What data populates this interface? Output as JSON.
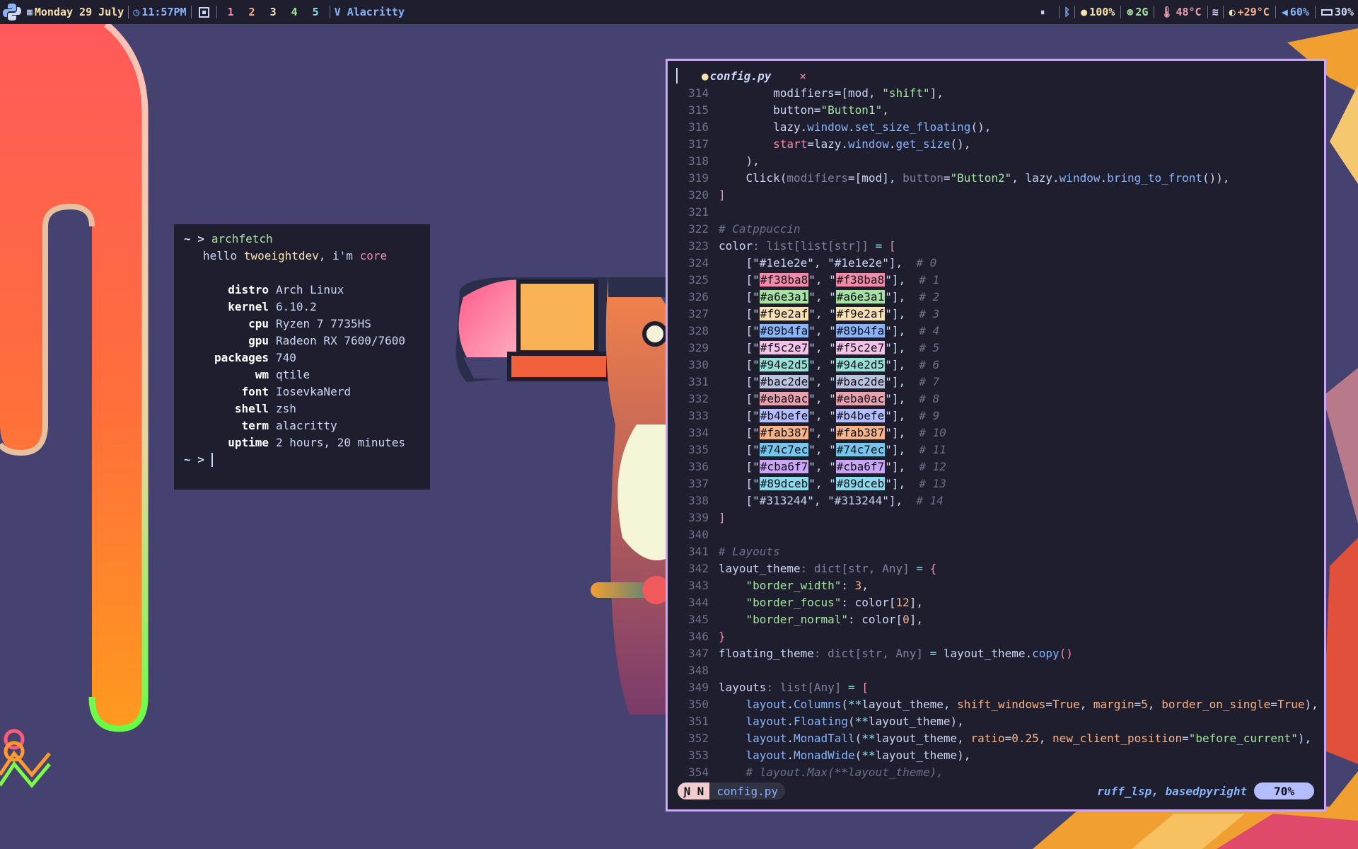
{
  "topbar": {
    "date": "Monday 29 July",
    "time": "11:57PM",
    "workspaces": [
      {
        "label": "1",
        "color": "#f38ba8"
      },
      {
        "label": "2",
        "color": "#fab387"
      },
      {
        "label": "3",
        "color": "#f9e2af"
      },
      {
        "label": "4",
        "color": "#a6e3a1"
      },
      {
        "label": "5",
        "color": "#89dceb"
      }
    ],
    "layout_glyph": "V",
    "window_title": "Alacritty",
    "pause_glyph": "⏸",
    "bluetooth_glyph": "ᛒ",
    "brightness": "100%",
    "memory": "2G",
    "cpu_temp": "48°C",
    "weather": "+29°C",
    "volume": "60%",
    "battery": "30%"
  },
  "fetch": {
    "prompt": "~ >",
    "command": "archfetch",
    "greeting_prefix": "hello ",
    "user": "twoeightdev",
    "greeting_mid": ", i'm ",
    "host": "core",
    "fields": [
      {
        "key": "distro",
        "value": "Arch Linux"
      },
      {
        "key": "kernel",
        "value": "6.10.2"
      },
      {
        "key": "cpu",
        "value": "Ryzen 7 7735HS"
      },
      {
        "key": "gpu",
        "value": "Radeon RX 7600/7600"
      },
      {
        "key": "packages",
        "value": "740"
      },
      {
        "key": "wm",
        "value": "qtile"
      },
      {
        "key": "font",
        "value": "IosevkaNerd"
      },
      {
        "key": "shell",
        "value": "zsh"
      },
      {
        "key": "term",
        "value": "alacritty"
      },
      {
        "key": "uptime",
        "value": "2 hours, 20 minutes"
      }
    ],
    "prompt2": "~ >"
  },
  "editor": {
    "tab_file": "config.py",
    "tab_close": "×",
    "mode": "N",
    "status_file": "config.py",
    "lsp": "ruff_lsp, basedpyright",
    "percent": "70%",
    "lines": [
      {
        "n": "314",
        "parts": [
          [
            "",
            "        modifiers=[mod, "
          ],
          [
            "str",
            "\"shift\""
          ],
          [
            "",
            "],"
          ]
        ]
      },
      {
        "n": "315",
        "parts": [
          [
            "",
            "        button="
          ],
          [
            "str",
            "\"Button1\""
          ],
          [
            "",
            ","
          ]
        ]
      },
      {
        "n": "316",
        "parts": [
          [
            "",
            "        lazy."
          ],
          [
            "fn",
            "window"
          ],
          [
            "",
            "."
          ],
          [
            "fn",
            "set_size_floating"
          ],
          [
            "",
            "(),"
          ]
        ]
      },
      {
        "n": "317",
        "parts": [
          [
            "red",
            "        start"
          ],
          [
            "",
            "=lazy."
          ],
          [
            "fn",
            "window"
          ],
          [
            "",
            "."
          ],
          [
            "fn",
            "get_size"
          ],
          [
            "",
            "(),"
          ]
        ]
      },
      {
        "n": "318",
        "parts": [
          [
            "",
            "    ),"
          ]
        ]
      },
      {
        "n": "319",
        "parts": [
          [
            "",
            "    Click("
          ],
          [
            "ty",
            "modifiers"
          ],
          [
            "",
            "=[mod], "
          ],
          [
            "ty",
            "button"
          ],
          [
            "",
            "="
          ],
          [
            "str",
            "\"Button2\""
          ],
          [
            "",
            ", lazy."
          ],
          [
            "fn",
            "window"
          ],
          [
            "",
            "."
          ],
          [
            "fn",
            "bring_to_front"
          ],
          [
            "",
            "()),"
          ]
        ]
      },
      {
        "n": "320",
        "parts": [
          [
            "red",
            "]"
          ]
        ]
      },
      {
        "n": "321",
        "parts": []
      },
      {
        "n": "322",
        "parts": [
          [
            "cm",
            "# Catppuccin"
          ]
        ]
      },
      {
        "n": "323",
        "parts": [
          [
            "",
            "color"
          ],
          [
            "ty",
            ": list[list[str]]"
          ],
          [
            "op",
            " = "
          ],
          [
            "red",
            "["
          ]
        ]
      },
      {
        "n": "324",
        "parts": [
          [
            "",
            "    [\""
          ],
          [
            "",
            "#1e1e2e"
          ],
          [
            "",
            "\", \""
          ],
          [
            "",
            "#1e1e2e"
          ],
          [
            "",
            "\"],  "
          ],
          [
            "cm",
            "# 0"
          ]
        ]
      },
      {
        "n": "325",
        "parts": [
          [
            "",
            "    [\""
          ],
          [
            "sw:#f38ba8",
            "#f38ba8"
          ],
          [
            "",
            "\", \""
          ],
          [
            "sw:#f38ba8",
            "#f38ba8"
          ],
          [
            "",
            "\"],  "
          ],
          [
            "cm",
            "# 1"
          ]
        ]
      },
      {
        "n": "326",
        "parts": [
          [
            "",
            "    [\""
          ],
          [
            "sw:#a6e3a1",
            "#a6e3a1"
          ],
          [
            "",
            "\", \""
          ],
          [
            "sw:#a6e3a1",
            "#a6e3a1"
          ],
          [
            "",
            "\"],  "
          ],
          [
            "cm",
            "# 2"
          ]
        ]
      },
      {
        "n": "327",
        "parts": [
          [
            "",
            "    [\""
          ],
          [
            "sw:#f9e2af",
            "#f9e2af"
          ],
          [
            "",
            "\", \""
          ],
          [
            "sw:#f9e2af",
            "#f9e2af"
          ],
          [
            "",
            "\"],  "
          ],
          [
            "cm",
            "# 3"
          ]
        ]
      },
      {
        "n": "328",
        "parts": [
          [
            "",
            "    [\""
          ],
          [
            "sw:#89b4fa",
            "#89b4fa"
          ],
          [
            "",
            "\", \""
          ],
          [
            "sw:#89b4fa",
            "#89b4fa"
          ],
          [
            "",
            "\"],  "
          ],
          [
            "cm",
            "# 4"
          ]
        ]
      },
      {
        "n": "329",
        "parts": [
          [
            "",
            "    [\""
          ],
          [
            "sw:#f5c2e7",
            "#f5c2e7"
          ],
          [
            "",
            "\", \""
          ],
          [
            "sw:#f5c2e7",
            "#f5c2e7"
          ],
          [
            "",
            "\"],  "
          ],
          [
            "cm",
            "# 5"
          ]
        ]
      },
      {
        "n": "330",
        "parts": [
          [
            "",
            "    [\""
          ],
          [
            "sw:#94e2d5",
            "#94e2d5"
          ],
          [
            "",
            "\", \""
          ],
          [
            "sw:#94e2d5",
            "#94e2d5"
          ],
          [
            "",
            "\"],  "
          ],
          [
            "cm",
            "# 6"
          ]
        ]
      },
      {
        "n": "331",
        "parts": [
          [
            "",
            "    [\""
          ],
          [
            "sw:#bac2de",
            "#bac2de"
          ],
          [
            "",
            "\", \""
          ],
          [
            "sw:#bac2de",
            "#bac2de"
          ],
          [
            "",
            "\"],  "
          ],
          [
            "cm",
            "# 7"
          ]
        ]
      },
      {
        "n": "332",
        "parts": [
          [
            "",
            "    [\""
          ],
          [
            "sw:#eba0ac",
            "#eba0ac"
          ],
          [
            "",
            "\", \""
          ],
          [
            "sw:#eba0ac",
            "#eba0ac"
          ],
          [
            "",
            "\"],  "
          ],
          [
            "cm",
            "# 8"
          ]
        ]
      },
      {
        "n": "333",
        "parts": [
          [
            "",
            "    [\""
          ],
          [
            "sw:#b4befe",
            "#b4befe"
          ],
          [
            "",
            "\", \""
          ],
          [
            "sw:#b4befe",
            "#b4befe"
          ],
          [
            "",
            "\"],  "
          ],
          [
            "cm",
            "# 9"
          ]
        ]
      },
      {
        "n": "334",
        "parts": [
          [
            "",
            "    [\""
          ],
          [
            "sw:#fab387",
            "#fab387"
          ],
          [
            "",
            "\", \""
          ],
          [
            "sw:#fab387",
            "#fab387"
          ],
          [
            "",
            "\"],  "
          ],
          [
            "cm",
            "# 10"
          ]
        ]
      },
      {
        "n": "335",
        "parts": [
          [
            "",
            "    [\""
          ],
          [
            "sw:#74c7ec",
            "#74c7ec"
          ],
          [
            "",
            "\", \""
          ],
          [
            "sw:#74c7ec",
            "#74c7ec"
          ],
          [
            "",
            "\"],  "
          ],
          [
            "cm",
            "# 11"
          ]
        ]
      },
      {
        "n": "336",
        "parts": [
          [
            "",
            "    [\""
          ],
          [
            "sw:#cba6f7",
            "#cba6f7"
          ],
          [
            "",
            "\", \""
          ],
          [
            "sw:#cba6f7",
            "#cba6f7"
          ],
          [
            "",
            "\"],  "
          ],
          [
            "cm",
            "# 12"
          ]
        ]
      },
      {
        "n": "337",
        "parts": [
          [
            "",
            "    [\""
          ],
          [
            "sw:#89dceb",
            "#89dceb"
          ],
          [
            "",
            "\", \""
          ],
          [
            "sw:#89dceb",
            "#89dceb"
          ],
          [
            "",
            "\"],  "
          ],
          [
            "cm",
            "# 13"
          ]
        ]
      },
      {
        "n": "338",
        "parts": [
          [
            "",
            "    [\""
          ],
          [
            "",
            "#313244"
          ],
          [
            "",
            "\", \""
          ],
          [
            "",
            "#313244"
          ],
          [
            "",
            "\"],  "
          ],
          [
            "cm",
            "# 14"
          ]
        ]
      },
      {
        "n": "339",
        "parts": [
          [
            "red",
            "]"
          ]
        ]
      },
      {
        "n": "340",
        "parts": []
      },
      {
        "n": "341",
        "parts": [
          [
            "cm",
            "# Layouts"
          ]
        ]
      },
      {
        "n": "342",
        "parts": [
          [
            "",
            "layout_theme"
          ],
          [
            "ty",
            ": dict[str, Any]"
          ],
          [
            "op",
            " = "
          ],
          [
            "red",
            "{"
          ]
        ]
      },
      {
        "n": "343",
        "parts": [
          [
            "",
            "    "
          ],
          [
            "str",
            "\"border_width\""
          ],
          [
            "",
            ": "
          ],
          [
            "num",
            "3"
          ],
          [
            "",
            ","
          ]
        ]
      },
      {
        "n": "344",
        "parts": [
          [
            "",
            "    "
          ],
          [
            "str",
            "\"border_focus\""
          ],
          [
            "",
            ": color["
          ],
          [
            "num",
            "12"
          ],
          [
            "",
            "],"
          ]
        ]
      },
      {
        "n": "345",
        "parts": [
          [
            "",
            "    "
          ],
          [
            "str",
            "\"border_normal\""
          ],
          [
            "",
            ": color["
          ],
          [
            "num",
            "0"
          ],
          [
            "",
            "],"
          ]
        ]
      },
      {
        "n": "346",
        "parts": [
          [
            "red",
            "}"
          ]
        ]
      },
      {
        "n": "347",
        "parts": [
          [
            "",
            "floating_theme"
          ],
          [
            "ty",
            ": dict[str, Any]"
          ],
          [
            "op",
            " = "
          ],
          [
            "",
            "layout_theme."
          ],
          [
            "fn",
            "copy"
          ],
          [
            "red",
            "()"
          ]
        ]
      },
      {
        "n": "348",
        "parts": []
      },
      {
        "n": "349",
        "parts": [
          [
            "",
            "layouts"
          ],
          [
            "ty",
            ": list[Any]"
          ],
          [
            "op",
            " = "
          ],
          [
            "red",
            "["
          ]
        ]
      },
      {
        "n": "350",
        "parts": [
          [
            "",
            "    "
          ],
          [
            "fn",
            "layout"
          ],
          [
            "",
            "."
          ],
          [
            "fn",
            "Columns"
          ],
          [
            "",
            "("
          ],
          [
            "op",
            "**"
          ],
          [
            "",
            "layout_theme, "
          ],
          [
            "num",
            "shift_windows"
          ],
          [
            "",
            "="
          ],
          [
            "num",
            "True"
          ],
          [
            "",
            ", "
          ],
          [
            "num",
            "margin"
          ],
          [
            "",
            "="
          ],
          [
            "num",
            "5"
          ],
          [
            "",
            ", "
          ],
          [
            "num",
            "border_on_single"
          ],
          [
            "",
            "="
          ],
          [
            "num",
            "True"
          ],
          [
            "",
            "),"
          ]
        ]
      },
      {
        "n": "351",
        "parts": [
          [
            "",
            "    "
          ],
          [
            "fn",
            "layout"
          ],
          [
            "",
            "."
          ],
          [
            "fn",
            "Floating"
          ],
          [
            "",
            "("
          ],
          [
            "op",
            "**"
          ],
          [
            "",
            "layout_theme),"
          ]
        ]
      },
      {
        "n": "352",
        "parts": [
          [
            "",
            "    "
          ],
          [
            "fn",
            "layout"
          ],
          [
            "",
            "."
          ],
          [
            "fn",
            "MonadTall"
          ],
          [
            "",
            "("
          ],
          [
            "op",
            "**"
          ],
          [
            "",
            "layout_theme, "
          ],
          [
            "num",
            "ratio"
          ],
          [
            "",
            "="
          ],
          [
            "num",
            "0.25"
          ],
          [
            "",
            ", "
          ],
          [
            "num",
            "new_client_position"
          ],
          [
            "",
            "="
          ],
          [
            "str",
            "\"before_current\""
          ],
          [
            "",
            "),"
          ]
        ]
      },
      {
        "n": "353",
        "parts": [
          [
            "",
            "    "
          ],
          [
            "fn",
            "layout"
          ],
          [
            "",
            "."
          ],
          [
            "fn",
            "MonadWide"
          ],
          [
            "",
            "("
          ],
          [
            "op",
            "**"
          ],
          [
            "",
            "layout_theme),"
          ]
        ]
      },
      {
        "n": "354",
        "parts": [
          [
            "cm",
            "    # layout.Max(**layout_theme),"
          ]
        ]
      }
    ]
  }
}
